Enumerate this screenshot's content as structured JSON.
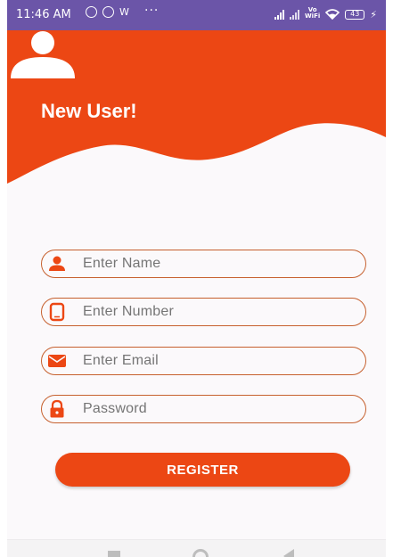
{
  "status_bar": {
    "time": "11:46 AM",
    "app_icons": [
      "D",
      "D",
      "W"
    ],
    "more": "···",
    "vowifi_top": "Vo",
    "vowifi_bottom": "WiFi",
    "battery": "43"
  },
  "header": {
    "title": "New User!",
    "avatar_icon": "person-icon",
    "bg_color": "#ec4714"
  },
  "form": {
    "fields": [
      {
        "icon": "person-icon",
        "placeholder": "Enter Name"
      },
      {
        "icon": "phone-icon",
        "placeholder": "Enter Number"
      },
      {
        "icon": "email-icon",
        "placeholder": "Enter Email"
      },
      {
        "icon": "lock-icon",
        "placeholder": "Password"
      }
    ],
    "register_label": "REGISTER",
    "accent_color": "#ec4714",
    "border_color": "#c6602e"
  },
  "nav": {
    "recent_icon": "recent-apps-icon",
    "home_icon": "home-icon",
    "back_icon": "back-icon"
  }
}
